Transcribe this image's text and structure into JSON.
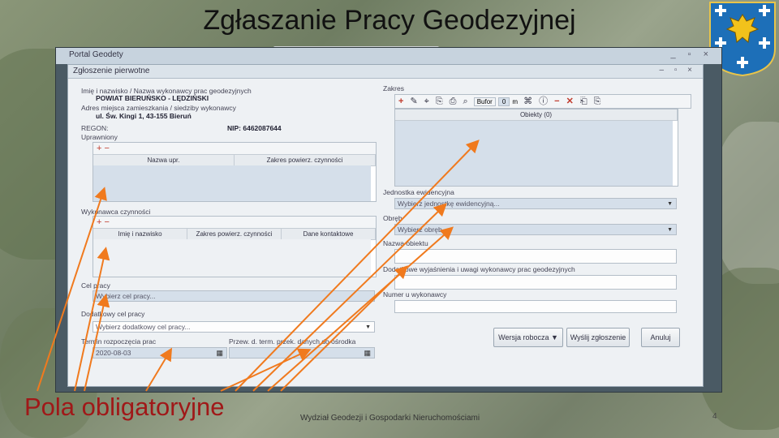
{
  "slide": {
    "title": "Zgłaszanie Pracy Geodezyjnej",
    "annotation": "Pola obligatoryjne",
    "footer": "Wydział Geodezji i Gospodarki Nieruchomościami",
    "page_number": "4"
  },
  "window": {
    "title": "Portal Geodety",
    "dialog_title": "Zgłoszenie pierwotne"
  },
  "form": {
    "contractor_label": "Imię i nazwisko / Nazwa wykonawcy prac geodezyjnych",
    "contractor_value": "POWIAT BIERUŃSKO - LĘDZIŃSKI",
    "address_label": "Adres miejsca zamieszkania / siedziby wykonawcy",
    "address_value": "ul. Św. Kingi 1, 43-155 Bieruń",
    "regon_label": "REGON:",
    "nip_label": "NIP: 6462087644",
    "uprawniony_label": "Uprawniony",
    "uprawniony_cols": [
      "Nazwa upr.",
      "Zakres powierz. czynności"
    ],
    "wykonawca_label": "Wykonawca czynności",
    "wykonawca_cols": [
      "Imię i nazwisko",
      "Zakres powierz. czynności",
      "Dane kontaktowe"
    ],
    "cel_label": "Cel pracy",
    "cel_placeholder": "Wybierz cel pracy...",
    "dod_cel_label": "Dodatkowy cel pracy",
    "dod_cel_placeholder": "Wybierz dodatkowy cel pracy...",
    "termin_label": "Termin rozpoczęcia prac",
    "termin_value": "2020-08-03",
    "przew_label": "Przew. d. term. przek. danych do ośrodka",
    "zakres_label": "Zakres",
    "zakres_bufor": "Bufor",
    "zakres_bufor_value": "0",
    "zakres_unit": "m",
    "zakres_col": "Obiekty (0)",
    "jednostka_label": "Jednostka ewidencyjna",
    "jednostka_placeholder": "Wybierz jednostkę ewidencyjną...",
    "obreb_label": "Obręb",
    "obreb_placeholder": "Wybierz obręb...",
    "nazwa_label": "Nazwa obiektu",
    "uwagi_label": "Dodatkowe wyjaśnienia i uwagi wykonawcy prac geodezyjnych",
    "numer_label": "Numer u wykonawcy"
  },
  "buttons": {
    "robocza": "Wersja robocza",
    "wyslij": "Wyślij zgłoszenie",
    "anuluj": "Anuluj"
  },
  "colors": {
    "annotation": "#a01818",
    "arrow": "#f07a1e",
    "required_field": "#d5dfea"
  }
}
